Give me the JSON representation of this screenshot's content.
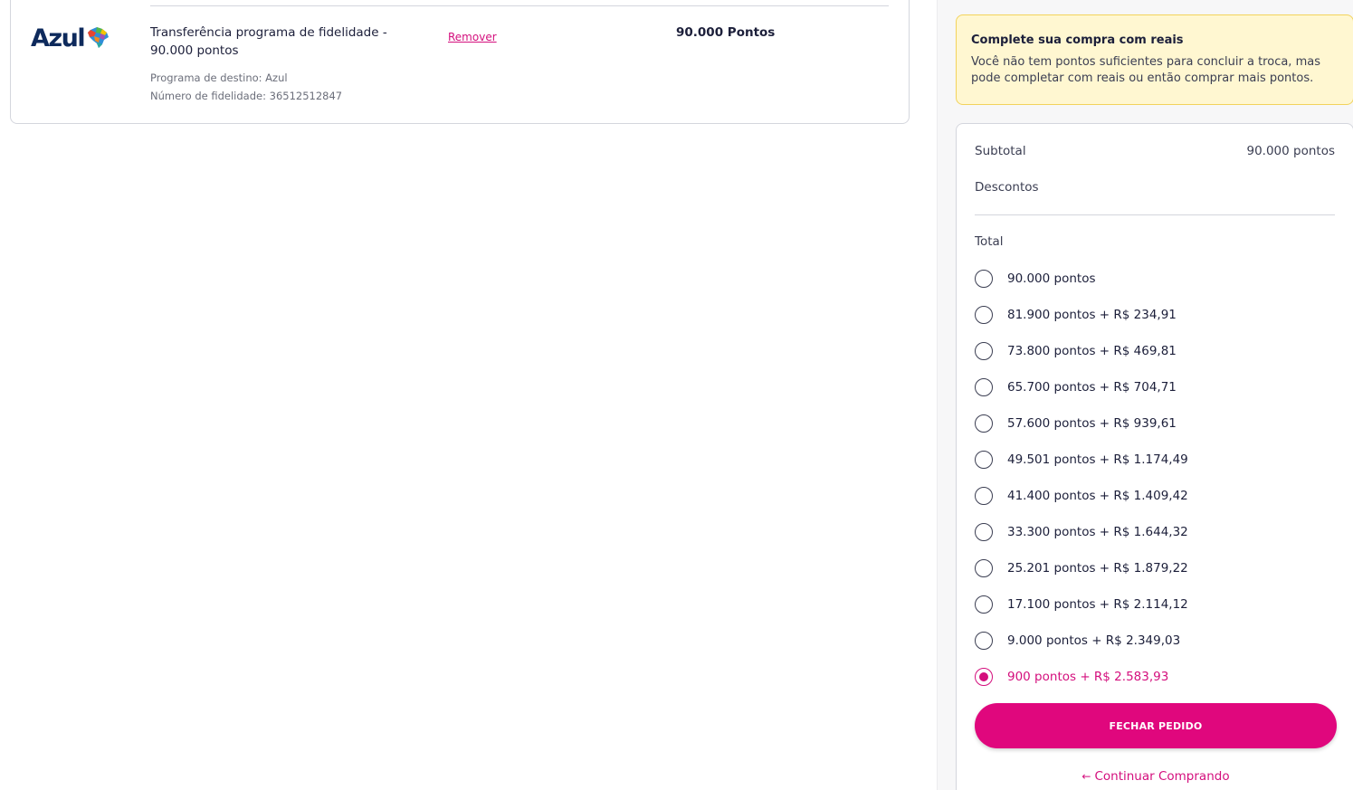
{
  "cart": {
    "logo_text": "Azul",
    "item_title": "Transferência programa de fidelidade - 90.000 pontos",
    "destination_program": "Programa de destino: Azul",
    "loyalty_number": "Número de fidelidade: 36512512847",
    "remove_label": "Remover",
    "points": "90.000 Pontos"
  },
  "alert": {
    "title": "Complete sua compra com reais",
    "text": "Você não tem pontos suficientes para concluir a troca, mas pode completar com reais ou então comprar mais pontos."
  },
  "summary": {
    "subtotal_label": "Subtotal",
    "subtotal_value": "90.000 pontos",
    "discounts_label": "Descontos",
    "total_label": "Total",
    "options": [
      {
        "label": "90.000 pontos",
        "selected": false
      },
      {
        "label": "81.900 pontos + R$ 234,91",
        "selected": false
      },
      {
        "label": "73.800 pontos + R$ 469,81",
        "selected": false
      },
      {
        "label": "65.700 pontos + R$ 704,71",
        "selected": false
      },
      {
        "label": "57.600 pontos + R$ 939,61",
        "selected": false
      },
      {
        "label": "49.501 pontos + R$ 1.174,49",
        "selected": false
      },
      {
        "label": "41.400 pontos + R$ 1.409,42",
        "selected": false
      },
      {
        "label": "33.300 pontos + R$ 1.644,32",
        "selected": false
      },
      {
        "label": "25.201 pontos + R$ 1.879,22",
        "selected": false
      },
      {
        "label": "17.100 pontos + R$ 2.114,12",
        "selected": false
      },
      {
        "label": "9.000 pontos + R$ 2.349,03",
        "selected": false
      },
      {
        "label": "900 pontos + R$ 2.583,93",
        "selected": true
      }
    ],
    "checkout_label": "FECHAR PEDIDO",
    "continue_label": "Continuar Comprando"
  },
  "colors": {
    "accent": "#e0077d",
    "alert_bg": "#fff7d1",
    "logo": "#0e2a5c"
  }
}
